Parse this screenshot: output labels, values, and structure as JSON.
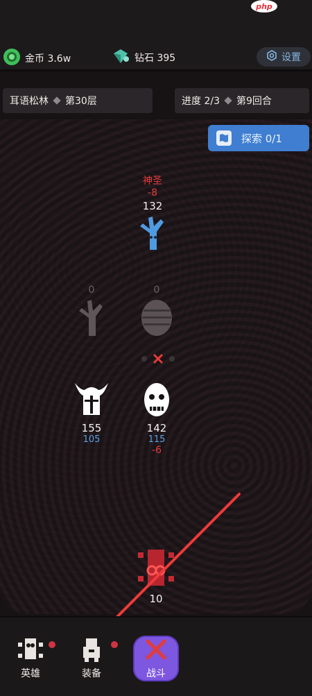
{
  "watermark": "php",
  "resources": {
    "gold": {
      "icon": "gold-coin-icon",
      "label": "金币 3.6w"
    },
    "diamond": {
      "icon": "diamond-icon",
      "label": "钻石 395"
    }
  },
  "settings": {
    "icon": "gear-icon",
    "label": "设置"
  },
  "stage": {
    "location": "耳语松林",
    "floor": "第30层"
  },
  "progress": {
    "progress_text": "进度 2/3",
    "round": "第9回合"
  },
  "explore": {
    "icon": "map-icon",
    "label": "探索 0/1"
  },
  "enemies": [
    {
      "name": "boss-tree",
      "icon": "tree-monster-icon",
      "status": "神圣",
      "damage": "-8",
      "hp": "132"
    },
    {
      "name": "dead-tree",
      "icon": "tree-monster-icon",
      "hp": "0"
    },
    {
      "name": "mummy",
      "icon": "mummy-icon",
      "hp": "0"
    }
  ],
  "allies": [
    {
      "name": "viking",
      "icon": "viking-helmet-icon",
      "hp": "155",
      "shield": "105"
    },
    {
      "name": "zombie",
      "icon": "zombie-head-icon",
      "hp": "142",
      "shield": "115",
      "damage": "-6"
    }
  ],
  "player": {
    "icon": "red-totem-icon",
    "hp": "10"
  },
  "tabs": [
    {
      "label": "英雄",
      "icon": "hero-icon"
    },
    {
      "label": "装备",
      "icon": "armor-icon"
    },
    {
      "label": "战斗",
      "icon": "crossed-swords-icon"
    }
  ],
  "colors": {
    "accent_blue": "#3f7ed0",
    "damage_red": "#e23b3b",
    "battle_purple": "#7e57e0"
  }
}
